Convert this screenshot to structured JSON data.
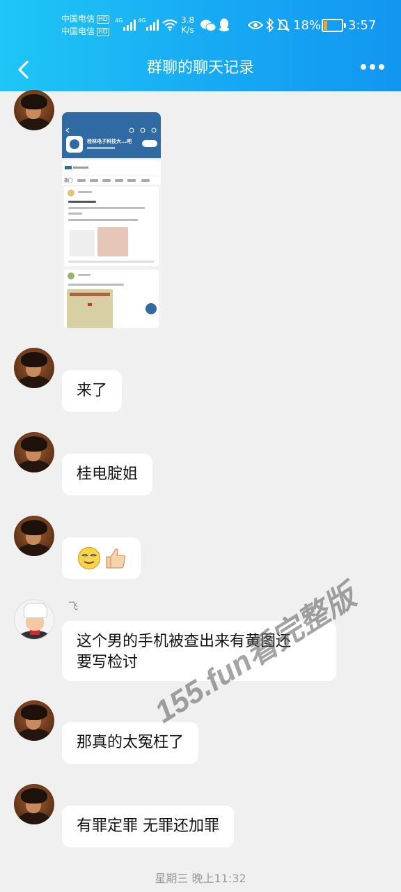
{
  "status_bar": {
    "carrier1": "中国电信",
    "carrier2": "中国电信",
    "hd": "HD",
    "net_type1": "4G",
    "net_type2": "4G",
    "net_speed_value": "3.8",
    "net_speed_unit": "K/s",
    "battery_percent": "18%",
    "battery_level": 0.18,
    "time": "3:57"
  },
  "nav": {
    "title": "群聊的聊天记录"
  },
  "messages": [
    {
      "sender": "",
      "type": "image",
      "image": {
        "group_name": "桂林电子科技大...吧",
        "tab_label": "热门"
      }
    },
    {
      "sender": "",
      "type": "text",
      "text": "来了"
    },
    {
      "sender": "",
      "type": "text",
      "text": "桂电腚姐"
    },
    {
      "sender": "",
      "type": "emoji",
      "emojis": [
        "smirk-face-icon",
        "thumbs-up-icon"
      ]
    },
    {
      "sender": "飞",
      "type": "text",
      "text_line1": "这个男的手机被查出来有黄图还",
      "text_line2": "要写检讨"
    },
    {
      "sender": "",
      "type": "text",
      "text": "那真的太冤枉了"
    },
    {
      "sender": "",
      "type": "text",
      "text": "有罪定罪 无罪还加罪"
    }
  ],
  "timestamp": "星期三 晚上11:32",
  "watermark": "155.fun看完整版",
  "colors": {
    "header_start": "#1fc6f6",
    "header_end": "#1296f0",
    "page_bg": "#f0f0f0",
    "bubble_bg": "#ffffff",
    "battery_fill": "#f6a623"
  }
}
